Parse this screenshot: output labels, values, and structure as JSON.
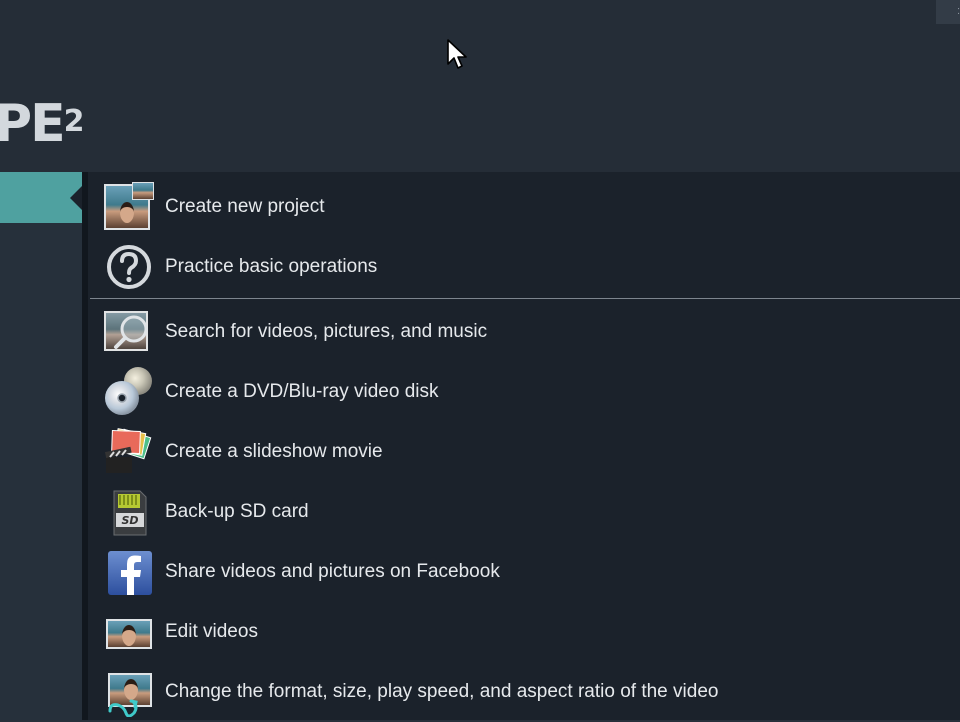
{
  "header": {
    "logo_text": "PE",
    "logo_sup": "2",
    "corner_button": ":"
  },
  "menu": {
    "items": [
      {
        "label": "Create new project",
        "icon": "new-project-icon"
      },
      {
        "label": "Practice basic operations",
        "icon": "question-mark-icon"
      },
      {
        "label": "Search for videos, pictures, and music",
        "icon": "search-media-icon"
      },
      {
        "label": "Create a DVD/Blu-ray video disk",
        "icon": "disc-icon"
      },
      {
        "label": "Create a slideshow movie",
        "icon": "slideshow-icon"
      },
      {
        "label": "Back-up SD card",
        "icon": "sd-card-icon"
      },
      {
        "label": "Share videos and pictures on Facebook",
        "icon": "facebook-icon"
      },
      {
        "label": "Edit videos",
        "icon": "edit-video-icon"
      },
      {
        "label": "Change the format, size, play speed, and aspect ratio of the video",
        "icon": "convert-video-icon"
      }
    ]
  },
  "colors": {
    "accent": "#4fa1a0",
    "background": "#1b222b",
    "header": "#252d37",
    "text": "#e6e9ec"
  }
}
